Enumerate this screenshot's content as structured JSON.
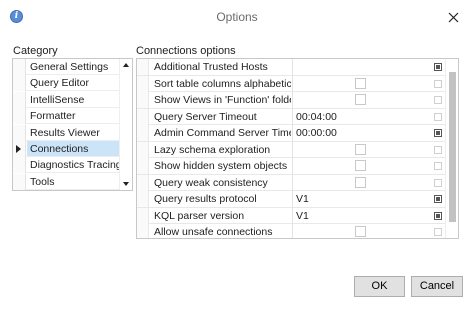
{
  "window": {
    "title": "Options",
    "icon": "info-icon"
  },
  "category": {
    "heading": "Category",
    "items": [
      {
        "label": "General Settings"
      },
      {
        "label": "Query Editor"
      },
      {
        "label": "IntelliSense"
      },
      {
        "label": "Formatter"
      },
      {
        "label": "Results Viewer"
      },
      {
        "label": "Connections"
      },
      {
        "label": "Diagnostics Tracing"
      },
      {
        "label": "Tools"
      }
    ],
    "selected": "Connections"
  },
  "options": {
    "heading": "Connections options",
    "rows": [
      {
        "name": "Additional Trusted Hosts",
        "value": "",
        "checkbox": false,
        "reset_active": true
      },
      {
        "name": "Sort table columns alphabetically",
        "value": "",
        "checkbox": true,
        "reset_active": false
      },
      {
        "name": "Show Views in 'Function' folder",
        "value": "",
        "checkbox": true,
        "reset_active": false
      },
      {
        "name": "Query Server Timeout",
        "value": "00:04:00",
        "checkbox": false,
        "reset_active": false
      },
      {
        "name": "Admin Command Server Timeout",
        "value": "00:00:00",
        "checkbox": false,
        "reset_active": true
      },
      {
        "name": "Lazy schema exploration",
        "value": "",
        "checkbox": true,
        "reset_active": false
      },
      {
        "name": "Show hidden system objects",
        "value": "",
        "checkbox": true,
        "reset_active": false
      },
      {
        "name": "Query weak consistency",
        "value": "",
        "checkbox": true,
        "reset_active": false
      },
      {
        "name": "Query results protocol",
        "value": "V1",
        "checkbox": false,
        "reset_active": true
      },
      {
        "name": "KQL parser version",
        "value": "V1",
        "checkbox": false,
        "reset_active": true
      },
      {
        "name": "Allow unsafe connections",
        "value": "",
        "checkbox": true,
        "reset_active": false
      }
    ]
  },
  "buttons": {
    "ok": "OK",
    "cancel": "Cancel"
  },
  "colors": {
    "selection": "#cce4f7",
    "button_bg": "#e1e1e1"
  }
}
